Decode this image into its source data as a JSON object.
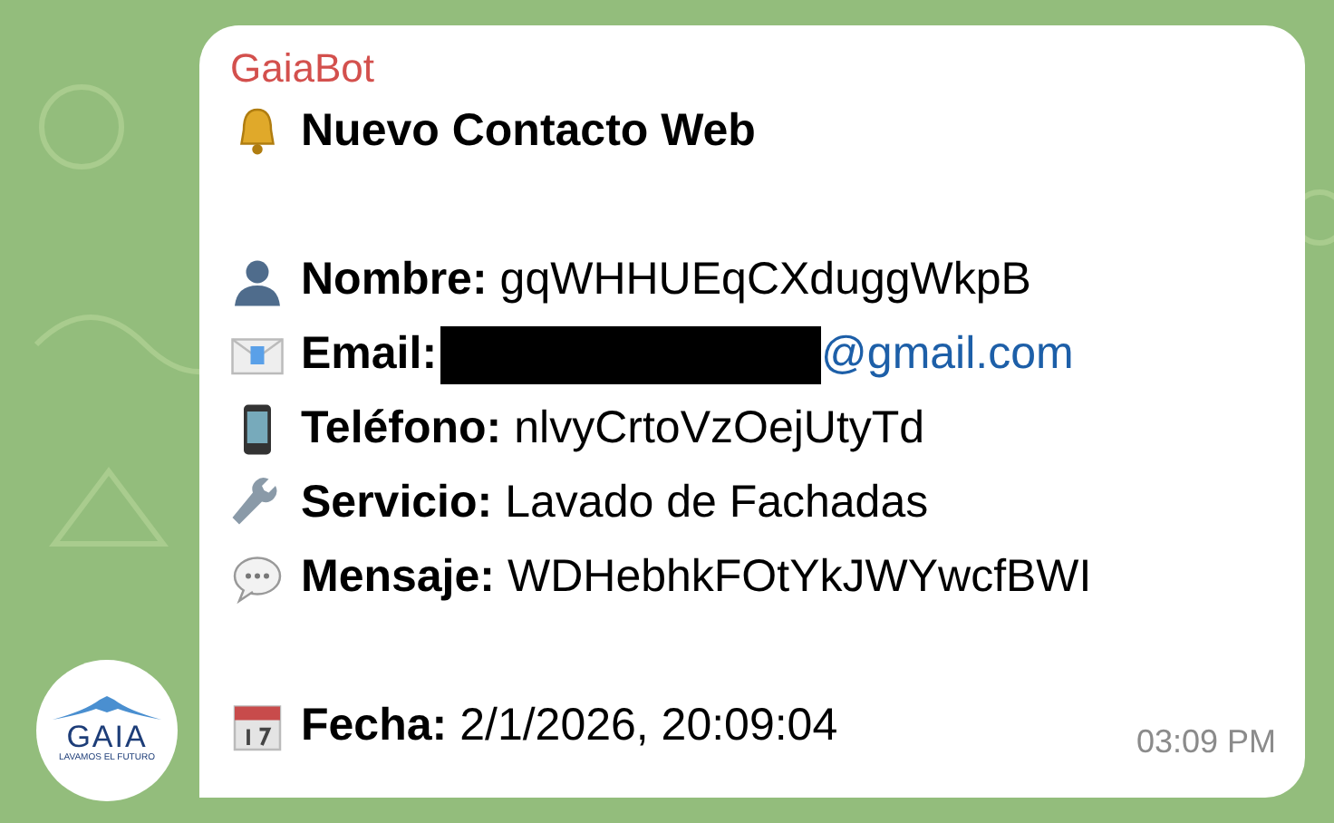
{
  "avatar": {
    "name": "GAIA",
    "tagline": "LAVAMOS EL FUTURO"
  },
  "message": {
    "sender": "GaiaBot",
    "title": "Nuevo Contacto Web",
    "fields": [
      {
        "kind": "person",
        "label": "Nombre:",
        "value": "gqWHHUEqCXduggWkpB"
      },
      {
        "kind": "email",
        "label": "Email:",
        "redacted": true,
        "value": "@gmail.com"
      },
      {
        "kind": "phone",
        "label": "Teléfono:",
        "value": "nlvyCrtoVzOejUtyTd"
      },
      {
        "kind": "wrench",
        "label": "Servicio:",
        "value": "Lavado de Fachadas"
      },
      {
        "kind": "speech",
        "label": "Mensaje:",
        "value": "WDHebhkFOtYkJWYwcfBWI"
      }
    ],
    "date": {
      "label": "Fecha:",
      "value": "2/1/2026, 20:09:04"
    },
    "time": "03:09 PM"
  }
}
